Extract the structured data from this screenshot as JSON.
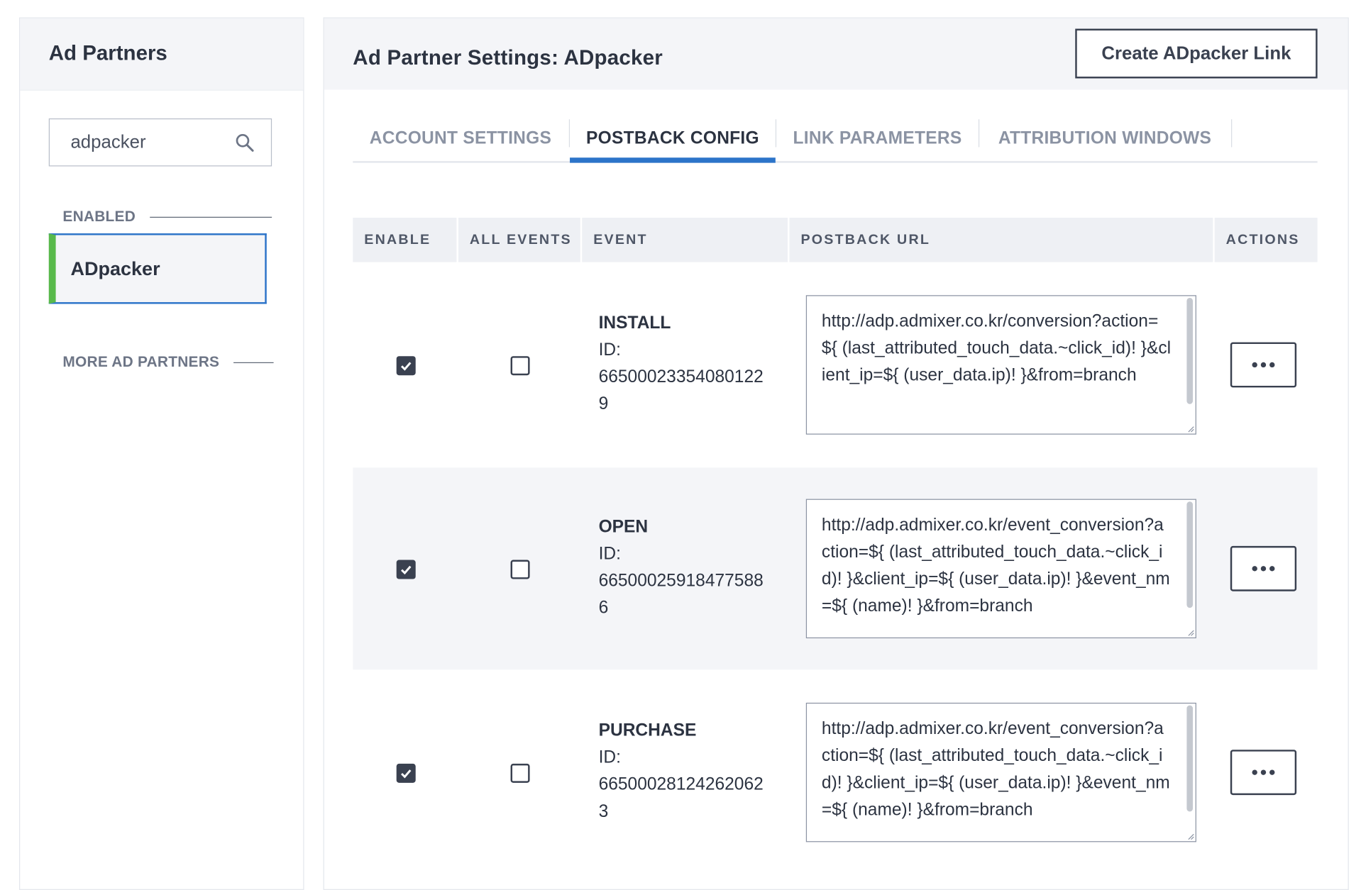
{
  "sidebar": {
    "title": "Ad Partners",
    "search": {
      "value": "adpacker",
      "icon": "search-icon"
    },
    "enabled_label": "ENABLED",
    "selected_partner": "ADpacker",
    "more_label": "MORE AD PARTNERS"
  },
  "main": {
    "title": "Ad Partner Settings: ADpacker",
    "create_button": "Create ADpacker Link",
    "tabs": [
      {
        "label": "ACCOUNT SETTINGS",
        "active": false
      },
      {
        "label": "POSTBACK CONFIG",
        "active": true
      },
      {
        "label": "LINK PARAMETERS",
        "active": false
      },
      {
        "label": "ATTRIBUTION WINDOWS",
        "active": false
      }
    ],
    "table": {
      "headers": {
        "enable": "ENABLE",
        "all_events": "ALL EVENTS",
        "event": "EVENT",
        "postback_url": "POSTBACK URL",
        "actions": "ACTIONS"
      },
      "rows": [
        {
          "enabled": true,
          "all_events": false,
          "event": "INSTALL",
          "id_label": "ID:",
          "id_line1": "66500023354080122",
          "id_line2": "9",
          "postback_url": "http://adp.admixer.co.kr/conversion?action=${ (last_attributed_touch_data.~click_id)! }&client_ip=${ (user_data.ip)! }&from=branch",
          "actions_label": "•••"
        },
        {
          "enabled": true,
          "all_events": false,
          "event": "OPEN",
          "id_label": "ID:",
          "id_line1": "66500025918477588",
          "id_line2": "6",
          "postback_url": "http://adp.admixer.co.kr/event_conversion?action=${ (last_attributed_touch_data.~click_id)! }&client_ip=${ (user_data.ip)! }&event_nm=${ (name)! }&from=branch",
          "actions_label": "•••"
        },
        {
          "enabled": true,
          "all_events": false,
          "event": "PURCHASE",
          "id_label": "ID:",
          "id_line1": "66500028124262062",
          "id_line2": "3",
          "postback_url": "http://adp.admixer.co.kr/event_conversion?action=${ (last_attributed_touch_data.~click_id)! }&client_ip=${ (user_data.ip)! }&event_nm=${ (name)! }&from=branch",
          "actions_label": "•••"
        }
      ]
    }
  },
  "colors": {
    "accent": "#2c74c9",
    "enabled_marker": "#58b94b",
    "header_bg": "#f4f5f8",
    "text": "#2c3341"
  }
}
